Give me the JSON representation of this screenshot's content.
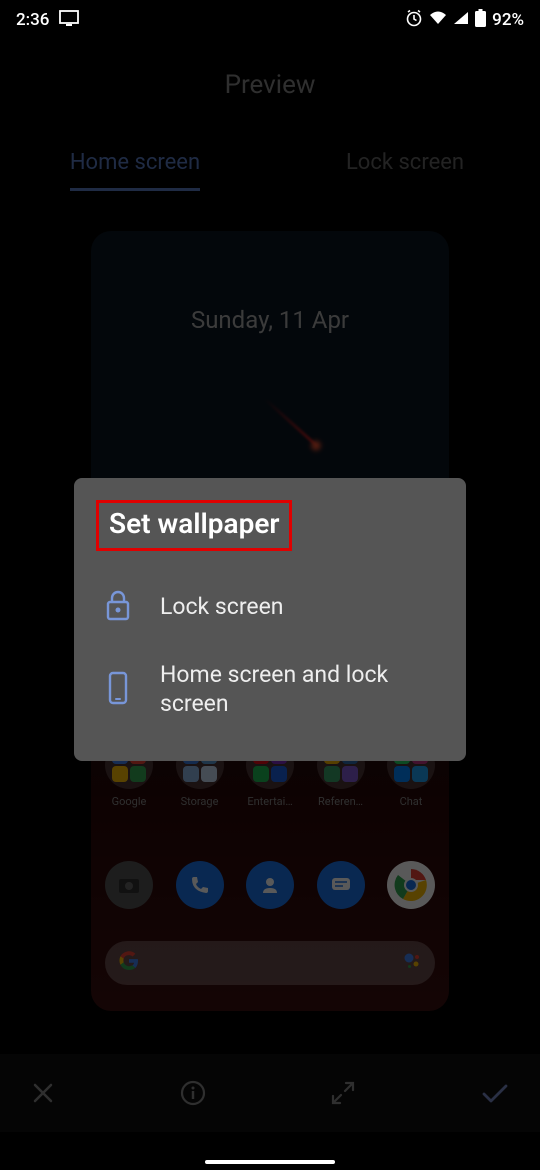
{
  "status": {
    "time": "2:36",
    "battery_pct": "92%"
  },
  "page_title": "Preview",
  "tabs": {
    "home": "Home screen",
    "lock": "Lock screen"
  },
  "preview": {
    "date": "Sunday, 11 Apr",
    "folders": [
      {
        "label": "Google"
      },
      {
        "label": "Storage"
      },
      {
        "label": "Entertai…"
      },
      {
        "label": "Referen…"
      },
      {
        "label": "Chat"
      }
    ]
  },
  "dialog": {
    "title": "Set wallpaper",
    "options": [
      {
        "label": "Lock screen",
        "icon": "lock"
      },
      {
        "label": "Home screen and lock screen",
        "icon": "phone"
      }
    ]
  }
}
